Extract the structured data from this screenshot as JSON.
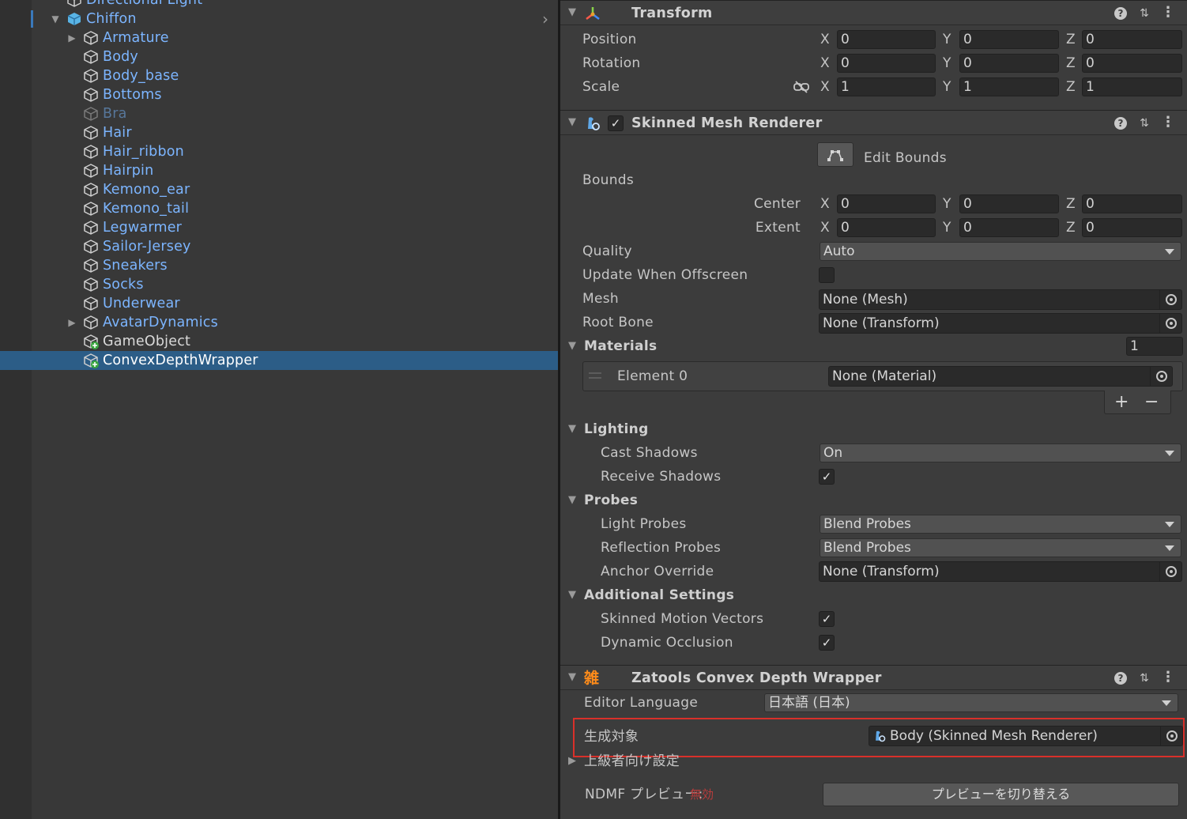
{
  "hierarchy": {
    "items": [
      {
        "label": "Directional Light"
      },
      {
        "label": "Chiffon"
      },
      {
        "label": "Armature"
      },
      {
        "label": "Body"
      },
      {
        "label": "Body_base"
      },
      {
        "label": "Bottoms"
      },
      {
        "label": "Bra"
      },
      {
        "label": "Hair"
      },
      {
        "label": "Hair_ribbon"
      },
      {
        "label": "Hairpin"
      },
      {
        "label": "Kemono_ear"
      },
      {
        "label": "Kemono_tail"
      },
      {
        "label": "Legwarmer"
      },
      {
        "label": "Sailor-Jersey"
      },
      {
        "label": "Sneakers"
      },
      {
        "label": "Socks"
      },
      {
        "label": "Underwear"
      },
      {
        "label": "AvatarDynamics"
      },
      {
        "label": "GameObject"
      },
      {
        "label": "ConvexDepthWrapper"
      }
    ],
    "selected": "ConvexDepthWrapper"
  },
  "transform": {
    "title": "Transform",
    "position": {
      "label": "Position",
      "x": "0",
      "y": "0",
      "z": "0"
    },
    "rotation": {
      "label": "Rotation",
      "x": "0",
      "y": "0",
      "z": "0"
    },
    "scale": {
      "label": "Scale",
      "x": "1",
      "y": "1",
      "z": "1"
    }
  },
  "axes": {
    "x": "X",
    "y": "Y",
    "z": "Z"
  },
  "smr": {
    "title": "Skinned Mesh Renderer",
    "edit_bounds": "Edit Bounds",
    "bounds": "Bounds",
    "center": {
      "label": "Center",
      "x": "0",
      "y": "0",
      "z": "0"
    },
    "extent": {
      "label": "Extent",
      "x": "0",
      "y": "0",
      "z": "0"
    },
    "quality": {
      "label": "Quality",
      "value": "Auto"
    },
    "update_offscreen": {
      "label": "Update When Offscreen"
    },
    "mesh": {
      "label": "Mesh",
      "value": "None (Mesh)"
    },
    "root_bone": {
      "label": "Root Bone",
      "value": "None (Transform)"
    },
    "materials": {
      "label": "Materials",
      "count": "1",
      "element0_label": "Element 0",
      "element0_value": "None (Material)",
      "add": "+",
      "remove": "−"
    },
    "lighting": {
      "label": "Lighting",
      "cast_label": "Cast Shadows",
      "cast_value": "On",
      "receive_label": "Receive Shadows"
    },
    "probes": {
      "label": "Probes",
      "light_label": "Light Probes",
      "light_value": "Blend Probes",
      "refl_label": "Reflection Probes",
      "refl_value": "Blend Probes",
      "anchor_label": "Anchor Override",
      "anchor_value": "None (Transform)"
    },
    "additional": {
      "label": "Additional Settings",
      "motion_label": "Skinned Motion Vectors",
      "occlusion_label": "Dynamic Occlusion"
    }
  },
  "zatools": {
    "title": "Zatools Convex Depth Wrapper",
    "icon_text": "雑",
    "lang_label": "Editor Language",
    "lang_value": "日本語 (日本)",
    "target_label": "生成対象",
    "target_value": "Body (Skinned Mesh Renderer)",
    "advanced_label": "上級者向け設定",
    "ndmf_label": "NDMF プレビュー:",
    "ndmf_state": "無効",
    "toggle_button": "プレビューを切り替える"
  },
  "colors": {
    "accent": "#7cb5ff",
    "selection": "#2c5d87",
    "highlight_frame": "#d9302a"
  }
}
